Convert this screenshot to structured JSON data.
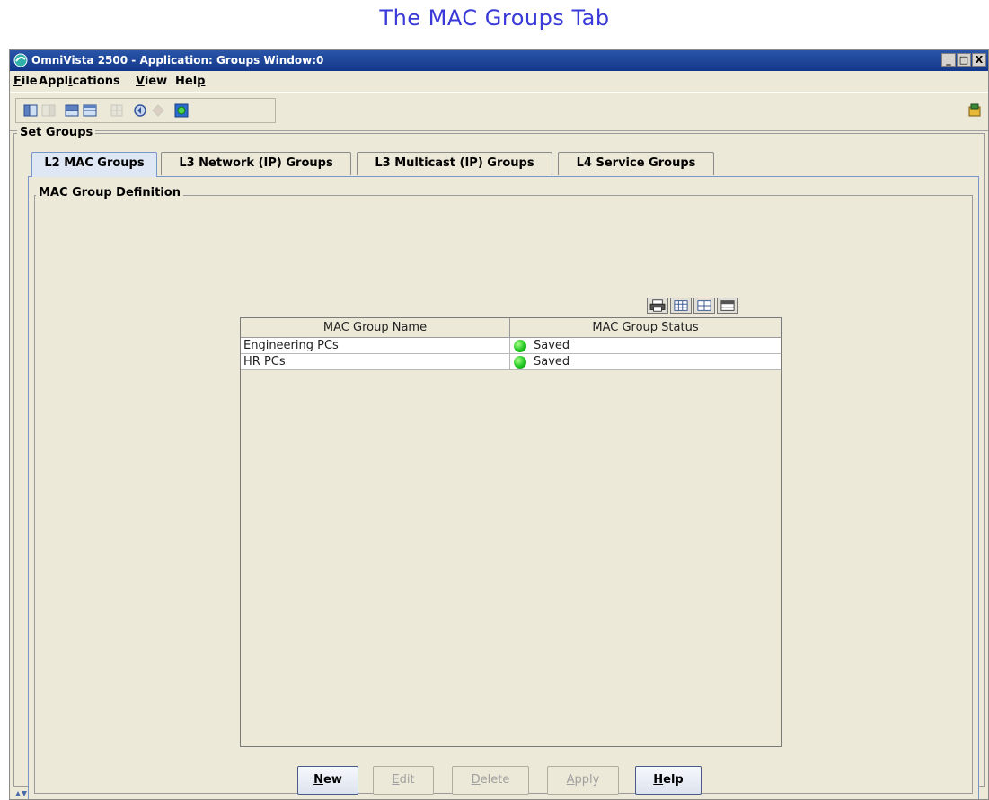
{
  "slide": {
    "title": "The MAC Groups Tab"
  },
  "window": {
    "title": "OmniVista 2500 -  Application: Groups  Window:0",
    "controls": {
      "minimize": "_",
      "maximize": "□",
      "close": "X"
    }
  },
  "menu": {
    "file": {
      "mnemonic": "F",
      "rest": "ile"
    },
    "applications": {
      "pre": "Appl",
      "mnemonic": "i",
      "rest": "cations"
    },
    "view": {
      "mnemonic": "V",
      "rest": "iew"
    },
    "help": {
      "pre": "Hel",
      "mnemonic": "p",
      "rest": ""
    }
  },
  "toolbar": {
    "icons": [
      "layout-left-icon",
      "layout-right-icon",
      "layout-top-icon",
      "layout-split-icon",
      "grid-icon",
      "refresh-icon",
      "stop-icon",
      "connect-icon",
      "exit-icon"
    ]
  },
  "set_groups": {
    "legend": "Set Groups"
  },
  "tabs": [
    {
      "label": "L2 MAC Groups",
      "active": true
    },
    {
      "label": "L3 Network (IP) Groups",
      "active": false
    },
    {
      "label": "L3 Multicast (IP) Groups",
      "active": false
    },
    {
      "label": "L4 Service Groups",
      "active": false
    }
  ],
  "definition": {
    "legend": "MAC Group Definition"
  },
  "table": {
    "tools": [
      "print-icon",
      "columns-icon",
      "filter-icon",
      "export-icon"
    ],
    "columns": [
      "MAC Group Name",
      "MAC Group Status"
    ],
    "rows": [
      {
        "name": "Engineering PCs",
        "status": "Saved",
        "status_color": "#1fc61f"
      },
      {
        "name": "HR PCs",
        "status": "Saved",
        "status_color": "#1fc61f"
      }
    ]
  },
  "buttons": {
    "new": {
      "mnemonic": "N",
      "rest": "ew",
      "enabled": true
    },
    "edit": {
      "mnemonic": "E",
      "rest": "dit",
      "enabled": false
    },
    "delete": {
      "mnemonic": "D",
      "rest": "elete",
      "enabled": false
    },
    "apply": {
      "mnemonic": "A",
      "rest": "pply",
      "enabled": false
    },
    "help": {
      "mnemonic": "H",
      "rest": "elp",
      "enabled": true
    }
  },
  "colors": {
    "accent": "#3a3ad8",
    "titlebar": "#12378a",
    "window_bg": "#ece9d8",
    "status_ok": "#1fc61f"
  }
}
